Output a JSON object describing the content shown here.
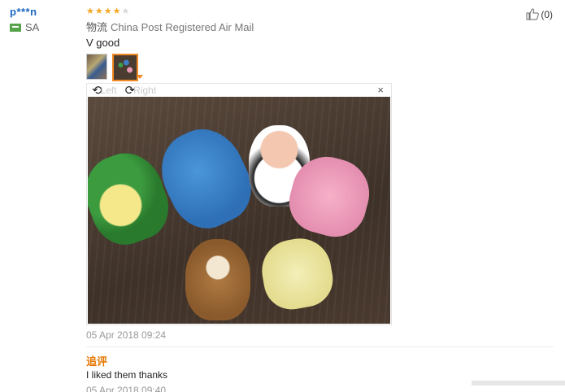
{
  "user": {
    "name": "p***n",
    "country": "SA"
  },
  "review": {
    "stars_filled": 4,
    "stars_total": 5,
    "logistics_label": "物流",
    "logistics_value": "China Post Registered Air Mail",
    "comment": "V good",
    "viewer": {
      "rotate_left_label": "Left",
      "rotate_right_label": "Right",
      "close_symbol": "×"
    },
    "date": "05 Apr 2018 09:24",
    "followup_title": "追评",
    "followup_comment": "I liked them thanks",
    "followup_date": "05 Apr 2018 09:40"
  },
  "helpful": {
    "count_text": "(0)"
  },
  "colors": {
    "user_link": "#1a66c2",
    "star": "#f5a623",
    "accent": "#f08a24",
    "followup_title": "#e67700"
  }
}
